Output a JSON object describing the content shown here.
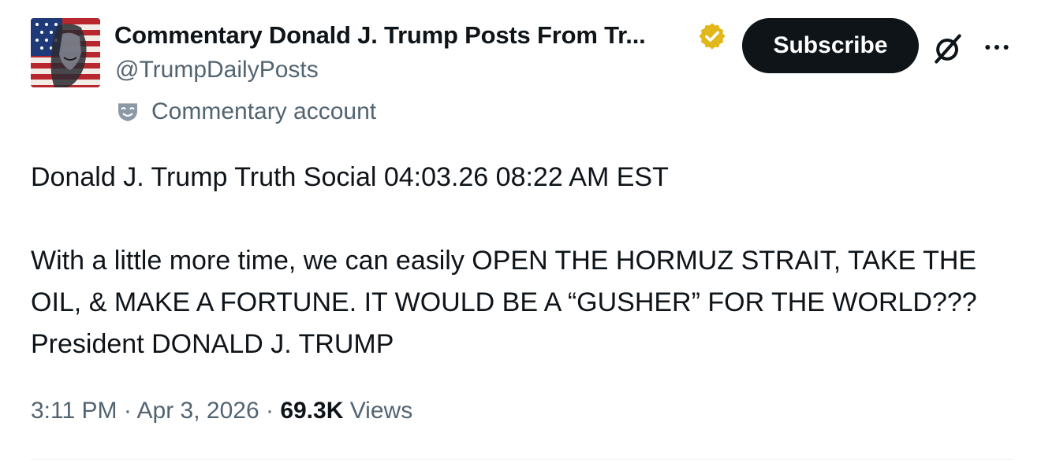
{
  "author": {
    "display_name": "Commentary Donald J. Trump Posts From Tr...",
    "handle": "@TrumpDailyPosts",
    "verified_badge_icon": "verified-gold-badge-icon",
    "verified_color": "#e2b719",
    "label_icon": "commentary-mask-icon",
    "label": "Commentary account"
  },
  "actions": {
    "subscribe_label": "Subscribe",
    "grok_icon": "grok-icon",
    "more_icon": "more-options-icon"
  },
  "tweet": {
    "header_line": "Donald J. Trump Truth Social 04:03.26 08:22 AM EST",
    "body": "With a little more time, we can easily OPEN THE HORMUZ STRAIT, TAKE THE OIL, & MAKE A FORTUNE. IT WOULD BE A “GUSHER” FOR THE WORLD??? President DONALD J. TRUMP"
  },
  "meta": {
    "time": "3:11 PM",
    "separator": " · ",
    "date": "Apr 3, 2026",
    "views_count": "69.3K",
    "views_label": "Views"
  },
  "colors": {
    "primary_text": "#0f1419",
    "secondary_text": "#536471",
    "button_bg": "#0f1419",
    "button_text": "#ffffff"
  }
}
